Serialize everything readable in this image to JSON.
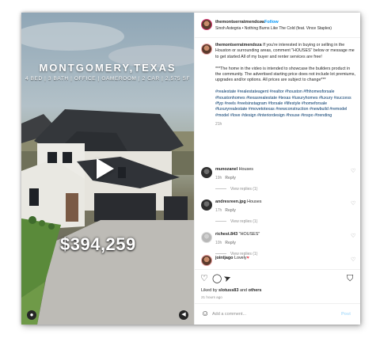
{
  "video": {
    "title": "MONTGOMERY,TEXAS",
    "subtitle": "4 BED | 3 BATH | OFFICE | GAMEROOM | 2 CAR | 2,575 SF",
    "price": "$394,259",
    "play_icon": "play-icon",
    "user_tag_icon": "person-icon",
    "mute_icon": "speaker-icon"
  },
  "header": {
    "username": "themontserratmendoza",
    "dot": "•",
    "follow_label": "Follow",
    "audio": "Sinoh Astegria • Nothing Burns Like The Cold (feat. Vince Staples)"
  },
  "caption": {
    "username": "themontserratmendoza",
    "text": "If you're interested in buying or selling in the Houston or surrounding areas, comment \"HOUSES\" below or message me to get started All of my buyer and renter services are free!",
    "disclaimer": "***The home in the video is intended to showcase the builders product in the community. The advertised starting price does not include lot premiums, upgrades and/or options. All prices are subject to change***",
    "hashtags": "#realestate #realestateagent #realtor #houston #fhhomesforsale #houstonhomes #texasrealestate #texas #luxuryhomes #luxury #success #fyp #reels #reelsinstagram #forsale #lifestyle #homeforsale #luxuryrealestate #movetotexas #newconstruction #newbuild #remodel #model #love #design #interiordesign #house #inspo #trending",
    "time": "21h"
  },
  "comments": [
    {
      "user": "munozanel",
      "text": "Houses",
      "time": "19h",
      "reply": "Reply",
      "replies": "View replies (1)",
      "heart": "♡"
    },
    {
      "user": "andresreen.jpg",
      "text": "Houses",
      "time": "17h",
      "reply": "Reply",
      "replies": "View replies (1)",
      "heart": "♡"
    },
    {
      "user": "richest.843",
      "text": "\"HOUSES\"",
      "time": "10h",
      "reply": "Reply",
      "replies": "View replies (1)",
      "heart": "♡"
    },
    {
      "user": "jointjago",
      "text": "Lovely",
      "emoji": "♥",
      "heart": "♡"
    }
  ],
  "actions": {
    "like_icon": "♡",
    "comment_icon": "◯",
    "share_icon": "➤",
    "save_icon": "⛉",
    "liked_by_prefix": "Liked by",
    "liked_by_user": "slotuss83",
    "liked_by_suffix": "and",
    "liked_by_others": "others",
    "time_ago": "21 hours ago"
  },
  "add_comment": {
    "emoji": "☺",
    "placeholder": "Add a comment...",
    "post_label": "Post"
  },
  "colors": {
    "accent_blue": "#0095f6",
    "hashtag_blue": "#00376b",
    "secondary_text": "#8e8e8e",
    "heart_red": "#ed4956"
  }
}
